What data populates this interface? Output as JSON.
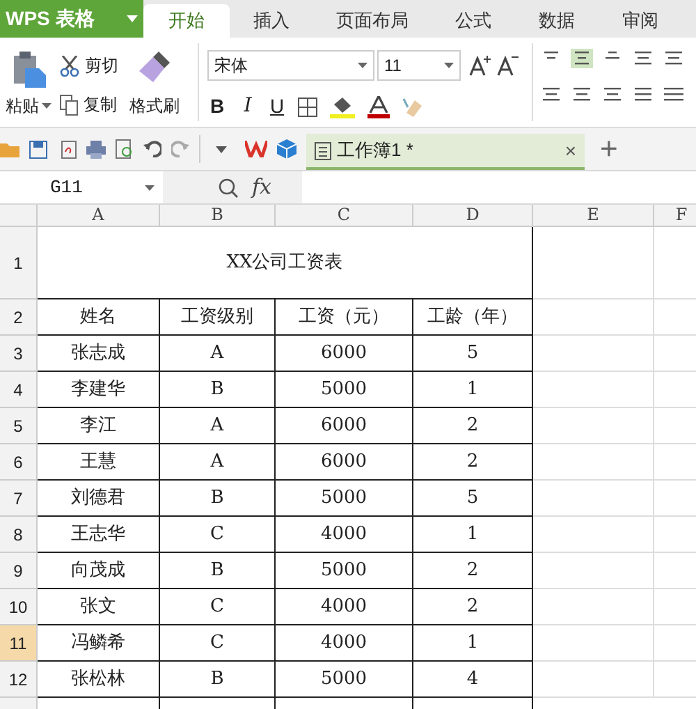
{
  "app": {
    "logo": "WPS 表格"
  },
  "tabs": [
    {
      "label": "开始",
      "selected": true
    },
    {
      "label": "插入",
      "selected": false
    },
    {
      "label": "页面布局",
      "selected": false
    },
    {
      "label": "公式",
      "selected": false
    },
    {
      "label": "数据",
      "selected": false
    },
    {
      "label": "审阅",
      "selected": false
    }
  ],
  "clipboard": {
    "paste": "粘贴",
    "cut": "剪切",
    "copy": "复制",
    "format_painter": "格式刷"
  },
  "font": {
    "name": "宋体",
    "size": "11",
    "bold": "B",
    "italic": "I",
    "underline": "U"
  },
  "document_tab": {
    "title": "工作簿1 *",
    "close": "×",
    "new": "+"
  },
  "formula_bar": {
    "cell": "G11",
    "fx": "fx"
  },
  "columns": [
    "A",
    "B",
    "C",
    "D",
    "E",
    "F"
  ],
  "title_row": {
    "number": "1",
    "text": "XX公司工资表"
  },
  "rows": [
    {
      "number": "2",
      "cells": [
        "姓名",
        "工资级别",
        "工资（元）",
        "工龄（年）"
      ],
      "selected": false
    },
    {
      "number": "3",
      "cells": [
        "张志成",
        "A",
        "6000",
        "5"
      ],
      "selected": false
    },
    {
      "number": "4",
      "cells": [
        "李建华",
        "B",
        "5000",
        "1"
      ],
      "selected": false
    },
    {
      "number": "5",
      "cells": [
        "李江",
        "A",
        "6000",
        "2"
      ],
      "selected": false
    },
    {
      "number": "6",
      "cells": [
        "王慧",
        "A",
        "6000",
        "2"
      ],
      "selected": false
    },
    {
      "number": "7",
      "cells": [
        "刘德君",
        "B",
        "5000",
        "5"
      ],
      "selected": false
    },
    {
      "number": "8",
      "cells": [
        "王志华",
        "C",
        "4000",
        "1"
      ],
      "selected": false
    },
    {
      "number": "9",
      "cells": [
        "向茂成",
        "B",
        "5000",
        "2"
      ],
      "selected": false
    },
    {
      "number": "10",
      "cells": [
        "张文",
        "C",
        "4000",
        "2"
      ],
      "selected": false
    },
    {
      "number": "11",
      "cells": [
        "冯鳞希",
        "C",
        "4000",
        "1"
      ],
      "selected": true
    },
    {
      "number": "12",
      "cells": [
        "张松林",
        "B",
        "5000",
        "4"
      ],
      "selected": false
    }
  ]
}
